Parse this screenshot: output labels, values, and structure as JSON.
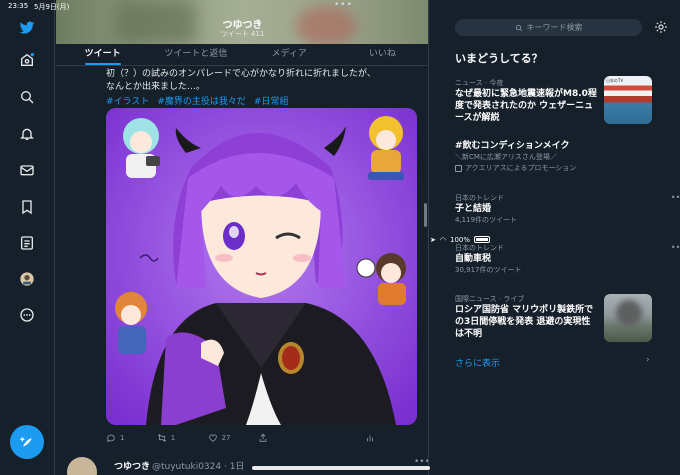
{
  "status_bar": {
    "time": "23:35",
    "date": "5月9日(月)",
    "battery": "100%"
  },
  "profile": {
    "name": "つゆつき",
    "tweet_count": "ツイート 411"
  },
  "tabs": [
    {
      "label": "ツイート"
    },
    {
      "label": "ツイートと返信"
    },
    {
      "label": "メディア"
    },
    {
      "label": "いいね"
    }
  ],
  "tweet": {
    "text_line1": "初（？）の試みのオンパレードで心がかなり折れに折れましたが、",
    "text_line2": "なんとか出来ました…。",
    "hashtags": [
      "#イラスト",
      "#魔界の主役は我々だ",
      "#日常組"
    ],
    "actions": {
      "reply_count": "1",
      "retweet_count": "1",
      "like_count": "27"
    }
  },
  "next_tweet": {
    "name": "つゆつき",
    "handle": "@tuyutuki0324 · 1日",
    "more": "•••"
  },
  "search": {
    "placeholder": "キーワード検索"
  },
  "trends": {
    "header": "いまどうしてる？",
    "items": [
      {
        "context": "ニュース · 今夜",
        "title": "なぜ最初に緊急地震速報がM8.0程度で発表されたのか ウェザーニュースが解説",
        "sub": ""
      },
      {
        "context": "",
        "title": "#飲むコンディションメイク",
        "sub": "＼新CMに広瀬アリスさん登場／",
        "promo": "アクエリアスによるプロモーション"
      },
      {
        "context": "日本のトレンド",
        "title": "子と結婚",
        "sub": "4,119件のツイート"
      },
      {
        "context": "日本のトレンド",
        "title": "自動車税",
        "sub": "30,917件のツイート"
      },
      {
        "context": "国際ニュース · ライブ",
        "title": "ロシア国防省 マリウポリ製鉄所での3日間停戦を発表 退避の実現性は不明",
        "sub": ""
      }
    ],
    "show_more": "さらに表示"
  }
}
